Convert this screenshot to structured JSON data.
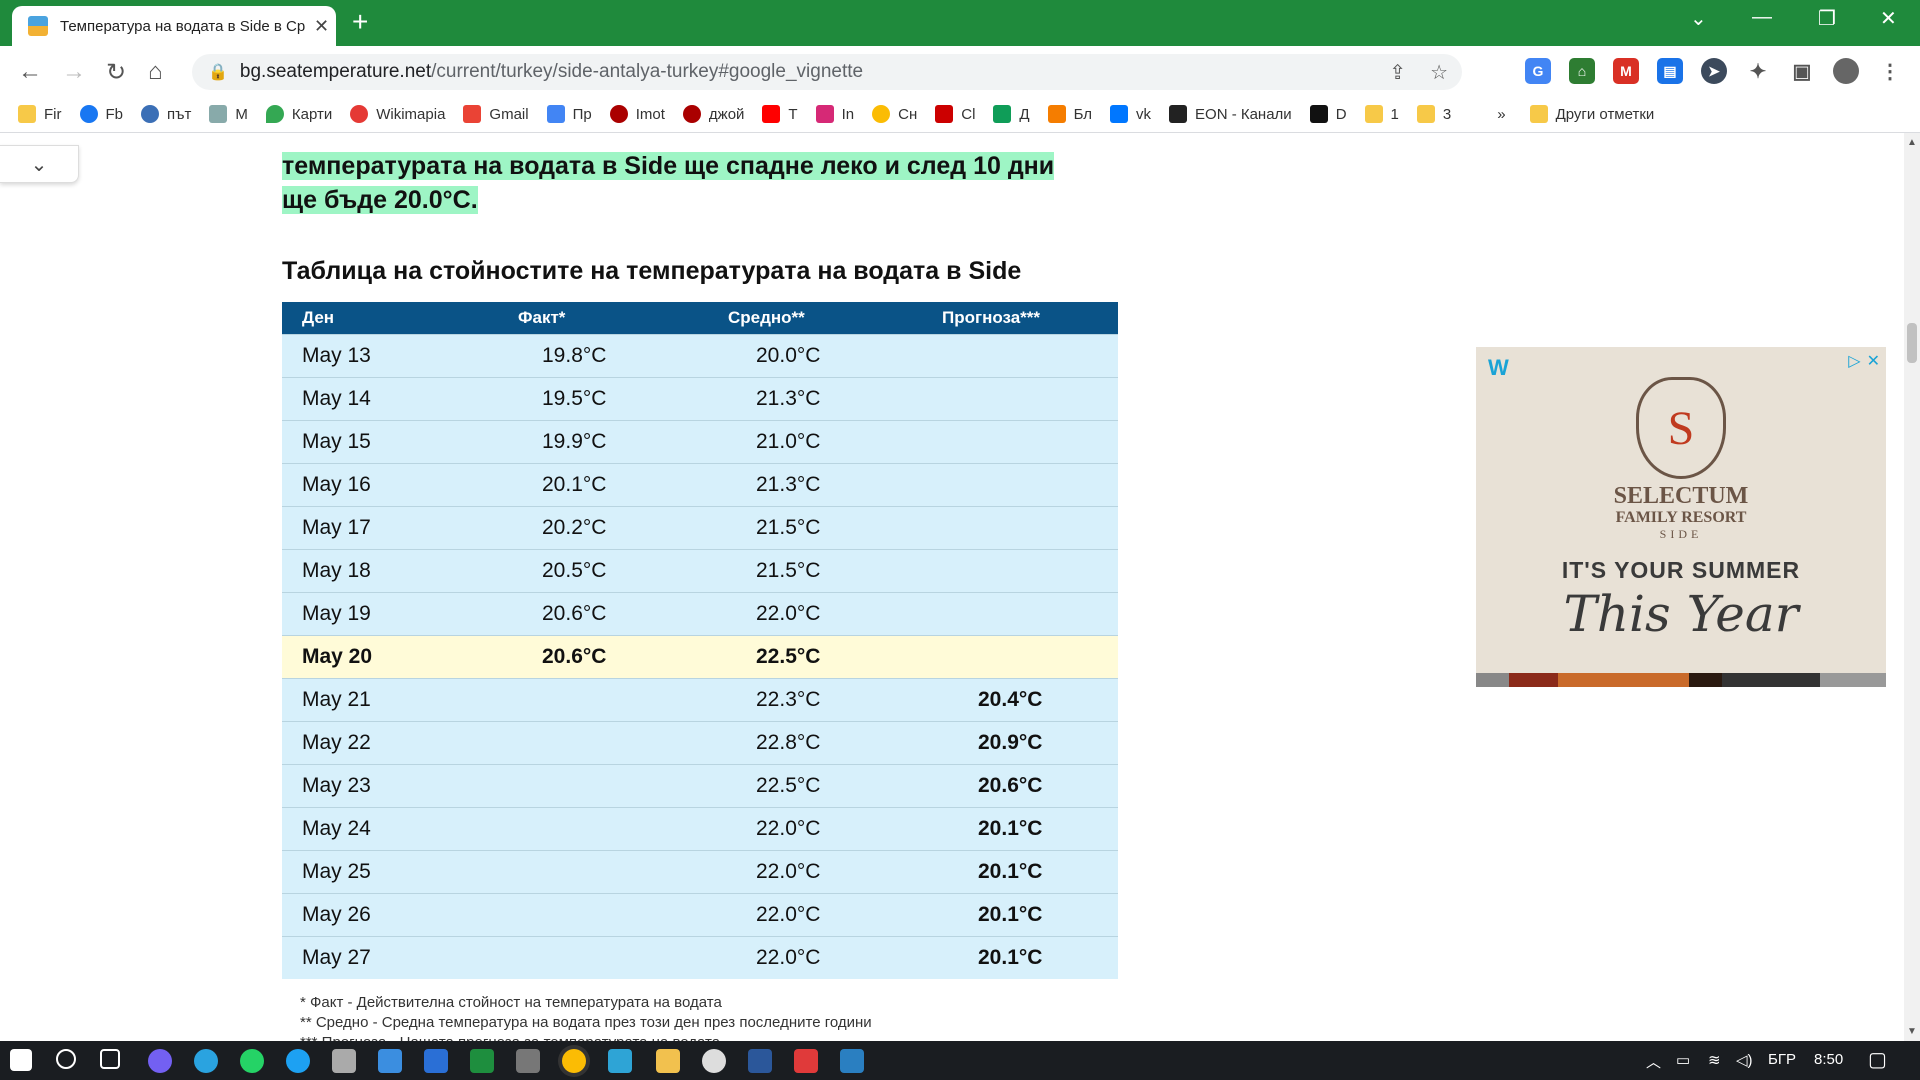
{
  "browser": {
    "tab_title": "Температура на водата в Side в Ср",
    "url_host": "bg.seatemperature.net",
    "url_path": "/current/turkey/side-antalya-turkey#google_vignette",
    "bookmarks": [
      "Fir",
      "Fb",
      "път",
      "M",
      "Карти",
      "Wikimapia",
      "Gmail",
      "Пр",
      "Imot",
      "джой",
      "T",
      "In",
      "Сн",
      "Cl",
      "Д",
      "Бл",
      "vk",
      "EON - Канали",
      "D",
      "1",
      "3"
    ],
    "other_bookmarks": "Други отметки",
    "overflow": "»"
  },
  "page": {
    "highlight_text": "температурата на водата в Side ще спадне леко и след 10 дни ще бъде 20.0°C.",
    "table_title": "Таблица на стойностите на температурата на водата в Side",
    "headers": {
      "day": "Ден",
      "fact": "Факт*",
      "avg": "Средно**",
      "forecast": "Прогноза***"
    },
    "rows": [
      {
        "day": "May 13",
        "fact": "19.8°C",
        "avg": "20.0°C",
        "forecast": ""
      },
      {
        "day": "May 14",
        "fact": "19.5°C",
        "avg": "21.3°C",
        "forecast": ""
      },
      {
        "day": "May 15",
        "fact": "19.9°C",
        "avg": "21.0°C",
        "forecast": ""
      },
      {
        "day": "May 16",
        "fact": "20.1°C",
        "avg": "21.3°C",
        "forecast": ""
      },
      {
        "day": "May 17",
        "fact": "20.2°C",
        "avg": "21.5°C",
        "forecast": ""
      },
      {
        "day": "May 18",
        "fact": "20.5°C",
        "avg": "21.5°C",
        "forecast": ""
      },
      {
        "day": "May 19",
        "fact": "20.6°C",
        "avg": "22.0°C",
        "forecast": ""
      },
      {
        "day": "May 20",
        "fact": "20.6°C",
        "avg": "22.5°C",
        "forecast": ""
      },
      {
        "day": "May 21",
        "fact": "",
        "avg": "22.3°C",
        "forecast": "20.4°C"
      },
      {
        "day": "May 22",
        "fact": "",
        "avg": "22.8°C",
        "forecast": "20.9°C"
      },
      {
        "day": "May 23",
        "fact": "",
        "avg": "22.5°C",
        "forecast": "20.6°C"
      },
      {
        "day": "May 24",
        "fact": "",
        "avg": "22.0°C",
        "forecast": "20.1°C"
      },
      {
        "day": "May 25",
        "fact": "",
        "avg": "22.0°C",
        "forecast": "20.1°C"
      },
      {
        "day": "May 26",
        "fact": "",
        "avg": "22.0°C",
        "forecast": "20.1°C"
      },
      {
        "day": "May 27",
        "fact": "",
        "avg": "22.0°C",
        "forecast": "20.1°C"
      }
    ],
    "notes": [
      "* Факт - Действителна стойност на температурата на водата",
      "** Средно - Средна температура на водата през този ден през последните години",
      "*** Прогноза - Нашата прогноза за температурата на водата"
    ]
  },
  "ad": {
    "brand1": "SELECTUM",
    "brand2": "FAMILY RESORT",
    "brand3": "SIDE",
    "slogan1": "IT'S YOUR SUMMER",
    "slogan2": "This Year",
    "logo_letter": "S"
  },
  "taskbar": {
    "lang": "БГР",
    "time": "8:50"
  },
  "colors": {
    "chrome_green": "#1f8a3c",
    "table_header": "#0a5387",
    "row_bg": "#d7f0fb",
    "today_bg": "#fffbd8",
    "highlight": "#9ef5c5"
  }
}
